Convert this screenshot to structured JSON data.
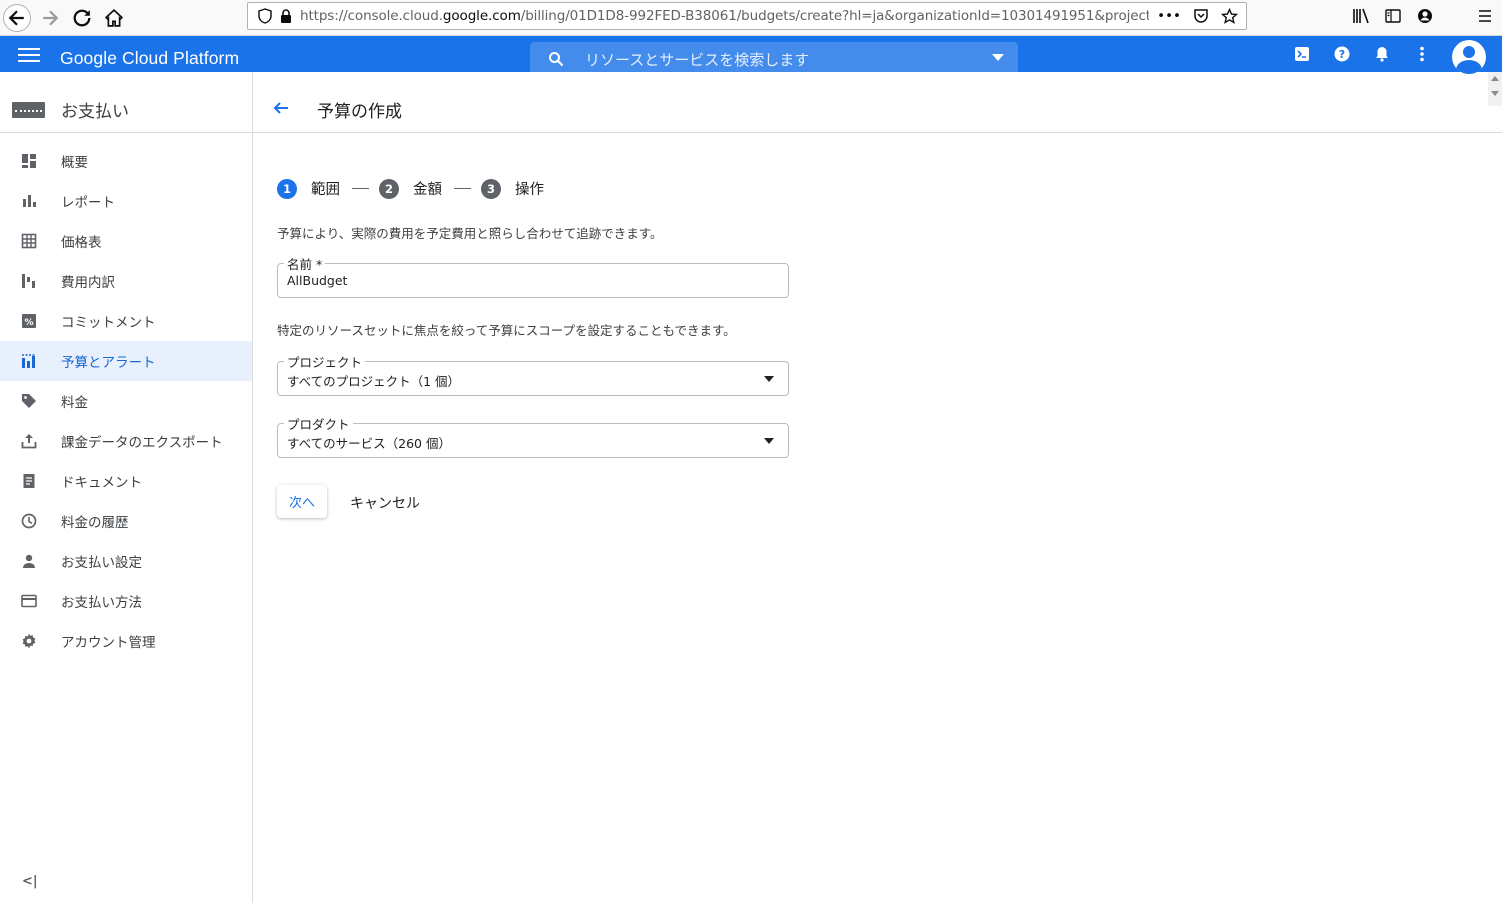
{
  "browser": {
    "url_prefix": "https://console.cloud.",
    "url_domain": "google.com",
    "url_rest": "/billing/01D1D8-992FED-B38061/budgets/create?hl=ja&organizationId=10301491951&project=sonorous-",
    "url_more": "•••"
  },
  "header": {
    "brand": "Google Cloud Platform",
    "search_placeholder": "リソースとサービスを検索します",
    "accent": "#1a73e8"
  },
  "sidebar": {
    "title": "お支払い",
    "items": [
      {
        "label": "概要",
        "icon": "dashboard-icon"
      },
      {
        "label": "レポート",
        "icon": "bar-chart-icon"
      },
      {
        "label": "価格表",
        "icon": "table-icon"
      },
      {
        "label": "費用内訳",
        "icon": "waterfall-icon"
      },
      {
        "label": "コミットメント",
        "icon": "percent-icon"
      },
      {
        "label": "予算とアラート",
        "icon": "budget-icon",
        "active": true
      },
      {
        "label": "料金",
        "icon": "tag-icon"
      },
      {
        "label": "課金データのエクスポート",
        "icon": "export-icon"
      },
      {
        "label": "ドキュメント",
        "icon": "document-icon"
      },
      {
        "label": "料金の履歴",
        "icon": "history-icon"
      },
      {
        "label": "お支払い設定",
        "icon": "person-icon"
      },
      {
        "label": "お支払い方法",
        "icon": "credit-card-icon"
      },
      {
        "label": "アカウント管理",
        "icon": "gear-icon"
      }
    ],
    "collapse": "<|"
  },
  "main": {
    "title": "予算の作成",
    "steps": [
      {
        "num": "1",
        "label": "範囲",
        "active": true
      },
      {
        "num": "2",
        "label": "金額"
      },
      {
        "num": "3",
        "label": "操作"
      }
    ],
    "intro": "予算により、実際の費用を予定費用と照らし合わせて追跡できます。",
    "name_label": "名前 *",
    "name_value": "AllBudget",
    "scope_desc": "特定のリソースセットに焦点を絞って予算にスコープを設定することもできます。",
    "project_label": "プロジェクト",
    "project_value": "すべてのプロジェクト（1 個）",
    "product_label": "プロダクト",
    "product_value": "すべてのサービス（260 個）",
    "next_label": "次へ",
    "cancel_label": "キャンセル"
  }
}
